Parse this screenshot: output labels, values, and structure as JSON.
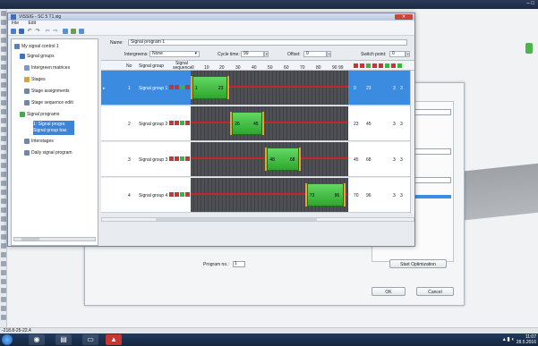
{
  "window": {
    "title": "VISSIG - SC 5 T1.sig",
    "menu": [
      "File",
      "Edit"
    ]
  },
  "outer_title": "",
  "tree": {
    "root": "My signal control 1",
    "items": [
      {
        "label": "Signal groups",
        "icon_color": "#3c73c4"
      },
      {
        "label": "Intergreen matrices",
        "icon_color": "#7a9ac8"
      },
      {
        "label": "Stages",
        "icon_color": "#d4a73a"
      },
      {
        "label": "Stage assignments",
        "icon_color": "#6e88aa"
      },
      {
        "label": "Stage sequence editi",
        "icon_color": "#6e88aa"
      },
      {
        "label": "Signal programs",
        "icon_color": "#3fae4a"
      },
      {
        "label": "1: Signal progra",
        "icon_color": "#3fae4a"
      },
      {
        "label": "Signal group bas",
        "icon_color": "#3fae4a"
      },
      {
        "label": "Interstages",
        "icon_color": "#6e88aa"
      },
      {
        "label": "Daily signal program",
        "icon_color": "#6e88aa"
      }
    ]
  },
  "form": {
    "name_label": "Name:",
    "name_value": "Signal program 1",
    "intergreens_label": "Intergreens:",
    "intergreens_value": "None",
    "cycle_label": "Cycle time:",
    "cycle_value": "99",
    "offset_label": "Offset:",
    "offset_value": "0",
    "switch_label": "Switch point:",
    "switch_value": "0"
  },
  "table": {
    "col_no": "No",
    "col_group": "Signal group",
    "col_seq": "Signal sequence",
    "ticks": [
      "0",
      "10",
      "20",
      "30",
      "40",
      "50",
      "60",
      "70",
      "80",
      "90 99"
    ],
    "rows": [
      {
        "no": "1",
        "name": "Signal group 1",
        "green_start": 1,
        "green_end": 23,
        "end_a": "0",
        "end_b": "23",
        "c1": "3",
        "c2": "3",
        "selected": true
      },
      {
        "no": "2",
        "name": "Signal group 2",
        "green_start": 26,
        "green_end": 45,
        "end_a": "23",
        "end_b": "45",
        "c1": "3",
        "c2": "3",
        "selected": false
      },
      {
        "no": "3",
        "name": "Signal group 3",
        "green_start": 48,
        "green_end": 68,
        "end_a": "45",
        "end_b": "68",
        "c1": "3",
        "c2": "3",
        "selected": false
      },
      {
        "no": "4",
        "name": "Signal group 4",
        "green_start": 73,
        "green_end": 96,
        "end_a": "70",
        "end_b": "96",
        "c1": "3",
        "c2": "3",
        "selected": false
      }
    ]
  },
  "bg_dialog": {
    "program_no_label": "Program no.:",
    "program_no_value": "1",
    "start_opt": "Start Optimization",
    "ok": "OK",
    "cancel": "Cancel"
  },
  "status_text": "-218.8-25-22.4",
  "taskbar": {
    "time": "11:07",
    "date": "28.5.2016"
  }
}
